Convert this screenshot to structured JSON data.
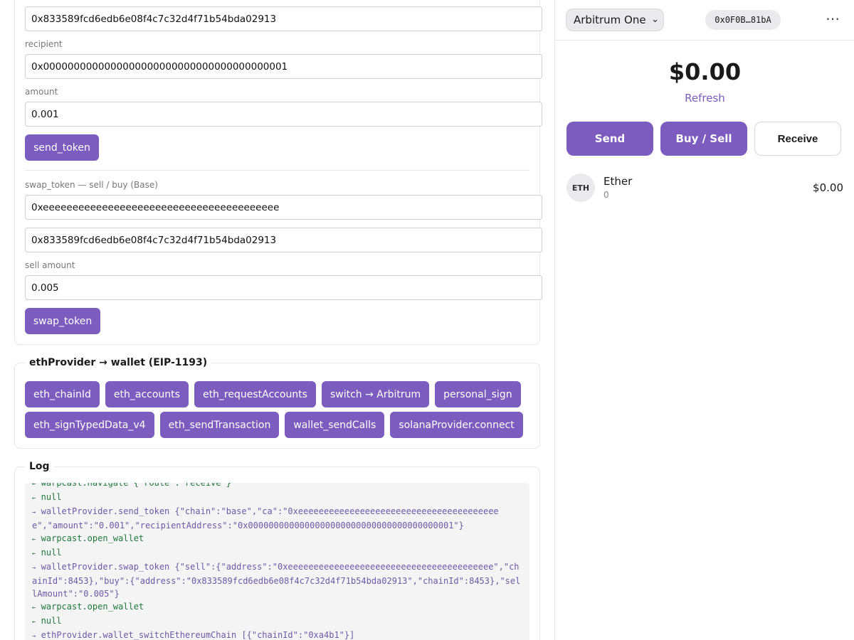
{
  "send_section": {
    "token_field_value": "0x833589fcd6edb6e08f4c7c32d4f71b54bda02913",
    "recipient_label": "recipient",
    "recipient_value": "0x0000000000000000000000000000000000000001",
    "amount_label": "amount",
    "amount_value": "0.001",
    "button_label": "send_token"
  },
  "swap_section": {
    "label": "swap_token — sell / buy (Base)",
    "sell_value": "0xeeeeeeeeeeeeeeeeeeeeeeeeeeeeeeeeeeeeeeee",
    "buy_value": "0x833589fcd6edb6e08f4c7c32d4f71b54bda02913",
    "sell_amount_label": "sell amount",
    "sell_amount_value": "0.005",
    "button_label": "swap_token"
  },
  "eth_provider": {
    "title": "ethProvider → wallet (EIP-1193)",
    "buttons": [
      "eth_chainId",
      "eth_accounts",
      "eth_requestAccounts",
      "switch → Arbitrum",
      "personal_sign",
      "eth_signTypedData_v4",
      "eth_sendTransaction",
      "wallet_sendCalls",
      "solanaProvider.connect"
    ]
  },
  "log": {
    "title": "Log",
    "lines": [
      {
        "dir": "in",
        "arrow": "←",
        "text": "warpcast.navigate {\"route\":\"receive\"}"
      },
      {
        "dir": "in",
        "arrow": "←",
        "text": "null"
      },
      {
        "dir": "out",
        "arrow": "→",
        "text": "walletProvider.send_token {\"chain\":\"base\",\"ca\":\"0xeeeeeeeeeeeeeeeeeeeeeeeeeeeeeeeeeeeeeeee\",\"amount\":\"0.001\",\"recipientAddress\":\"0x0000000000000000000000000000000000000001\"}"
      },
      {
        "dir": "in",
        "arrow": "←",
        "text": "warpcast.open_wallet"
      },
      {
        "dir": "in",
        "arrow": "←",
        "text": "null"
      },
      {
        "dir": "out",
        "arrow": "→",
        "text": "walletProvider.swap_token {\"sell\":{\"address\":\"0xeeeeeeeeeeeeeeeeeeeeeeeeeeeeeeeeeeeeeeee\",\"chainId\":8453},\"buy\":{\"address\":\"0x833589fcd6edb6e08f4c7c32d4f71b54bda02913\",\"chainId\":8453},\"sellAmount\":\"0.005\"}"
      },
      {
        "dir": "in",
        "arrow": "←",
        "text": "warpcast.open_wallet"
      },
      {
        "dir": "in",
        "arrow": "←",
        "text": "null"
      },
      {
        "dir": "out",
        "arrow": "→",
        "text": "ethProvider.wallet_switchEthereumChain [{\"chainId\":\"0xa4b1\"}]"
      }
    ]
  },
  "wallet": {
    "network": "Arbitrum One",
    "address": "0x0F0B…81bA",
    "more_icon": "⋯",
    "balance": "$0.00",
    "refresh_label": "Refresh",
    "send_label": "Send",
    "buy_sell_label": "Buy / Sell",
    "receive_label": "Receive",
    "accent_color": "#7c5cbf",
    "tokens": [
      {
        "symbol": "ETH",
        "name": "Ether",
        "balance": "0",
        "usd": "$0.00"
      }
    ]
  }
}
